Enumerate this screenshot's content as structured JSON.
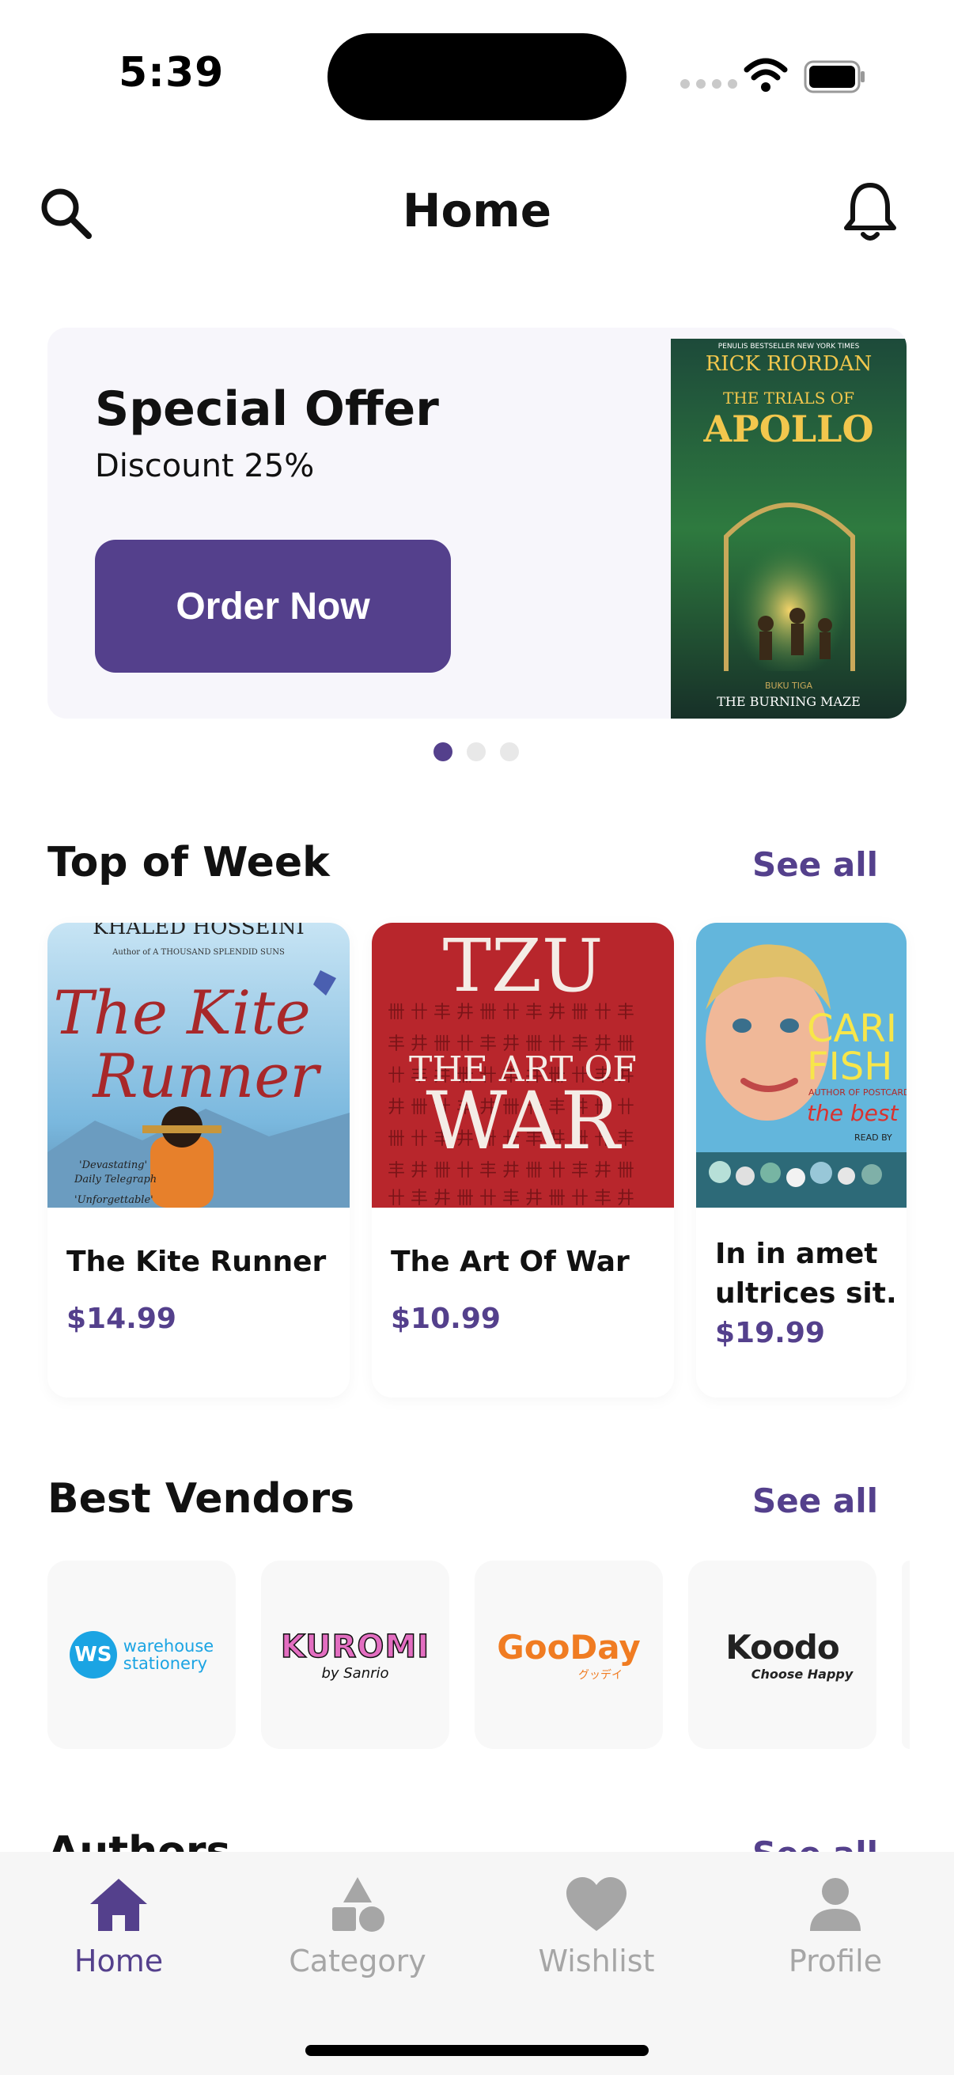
{
  "status_bar": {
    "time": "5:39",
    "icons": [
      "cellular-icon",
      "wifi-icon",
      "battery-icon"
    ]
  },
  "header": {
    "title": "Home",
    "search_icon": "search-icon",
    "bell_icon": "bell-icon"
  },
  "banner": {
    "title": "Special Offer",
    "subtitle": "Discount 25%",
    "button_label": "Order Now",
    "cover": {
      "top_line": "PENULIS BESTSELLER NEW YORK TIMES",
      "author": "RICK RIORDAN",
      "series": "THE TRIALS OF",
      "name": "APOLLO",
      "book": "BUKU TIGA",
      "subtitle": "THE BURNING MAZE"
    },
    "pages": 3,
    "active_page": 1
  },
  "sections": {
    "top_of_week": {
      "title": "Top of Week",
      "see_all": "See all"
    },
    "best_vendors": {
      "title": "Best Vendors",
      "see_all": "See all"
    },
    "authors": {
      "title": "Authors",
      "see_all": "See all"
    }
  },
  "books": [
    {
      "title": "The Kite Runner",
      "price": "$14.99",
      "cover": {
        "author": "KHALED HOSSEINI",
        "tagline": "Author of A THOUSAND SPLENDID SUNS",
        "line1": "The Kite",
        "line2": "Runner",
        "quote1": "'Devastating'",
        "quote2": "Daily Telegraph",
        "quote3": "'Unforgettable'"
      }
    },
    {
      "title": "The Art Of War",
      "price": "$10.99",
      "cover": {
        "top": "TZU",
        "line1": "THE ART OF",
        "line2": "WAR"
      }
    },
    {
      "title": "In in amet ultrices sit.",
      "price": "$19.99",
      "cover": {
        "name1": "CARI",
        "name2": "FISH",
        "tagline": "AUTHOR OF POSTCARDS",
        "best": "the best",
        "read": "READ BY"
      }
    }
  ],
  "vendors": [
    {
      "name": "warehouse stationery",
      "badge": "WS",
      "line1": "warehouse",
      "line2": "stationery"
    },
    {
      "name": "Kuromi",
      "line1": "KUROMI",
      "line2": "by Sanrio"
    },
    {
      "name": "GooDay",
      "line1": "GooDay",
      "line2": "グッデイ"
    },
    {
      "name": "Koodo",
      "line1": "Koodo",
      "line2": "Choose Happy"
    }
  ],
  "bottom_nav": [
    {
      "label": "Home",
      "icon": "home-icon",
      "active": true
    },
    {
      "label": "Category",
      "icon": "category-icon",
      "active": false
    },
    {
      "label": "Wishlist",
      "icon": "heart-icon",
      "active": false
    },
    {
      "label": "Profile",
      "icon": "profile-icon",
      "active": false
    }
  ],
  "colors": {
    "accent": "#54408c",
    "inactive": "#a6a6a6",
    "banner_bg": "#f7f6fb",
    "vendor_bg": "#f8f8f8"
  }
}
